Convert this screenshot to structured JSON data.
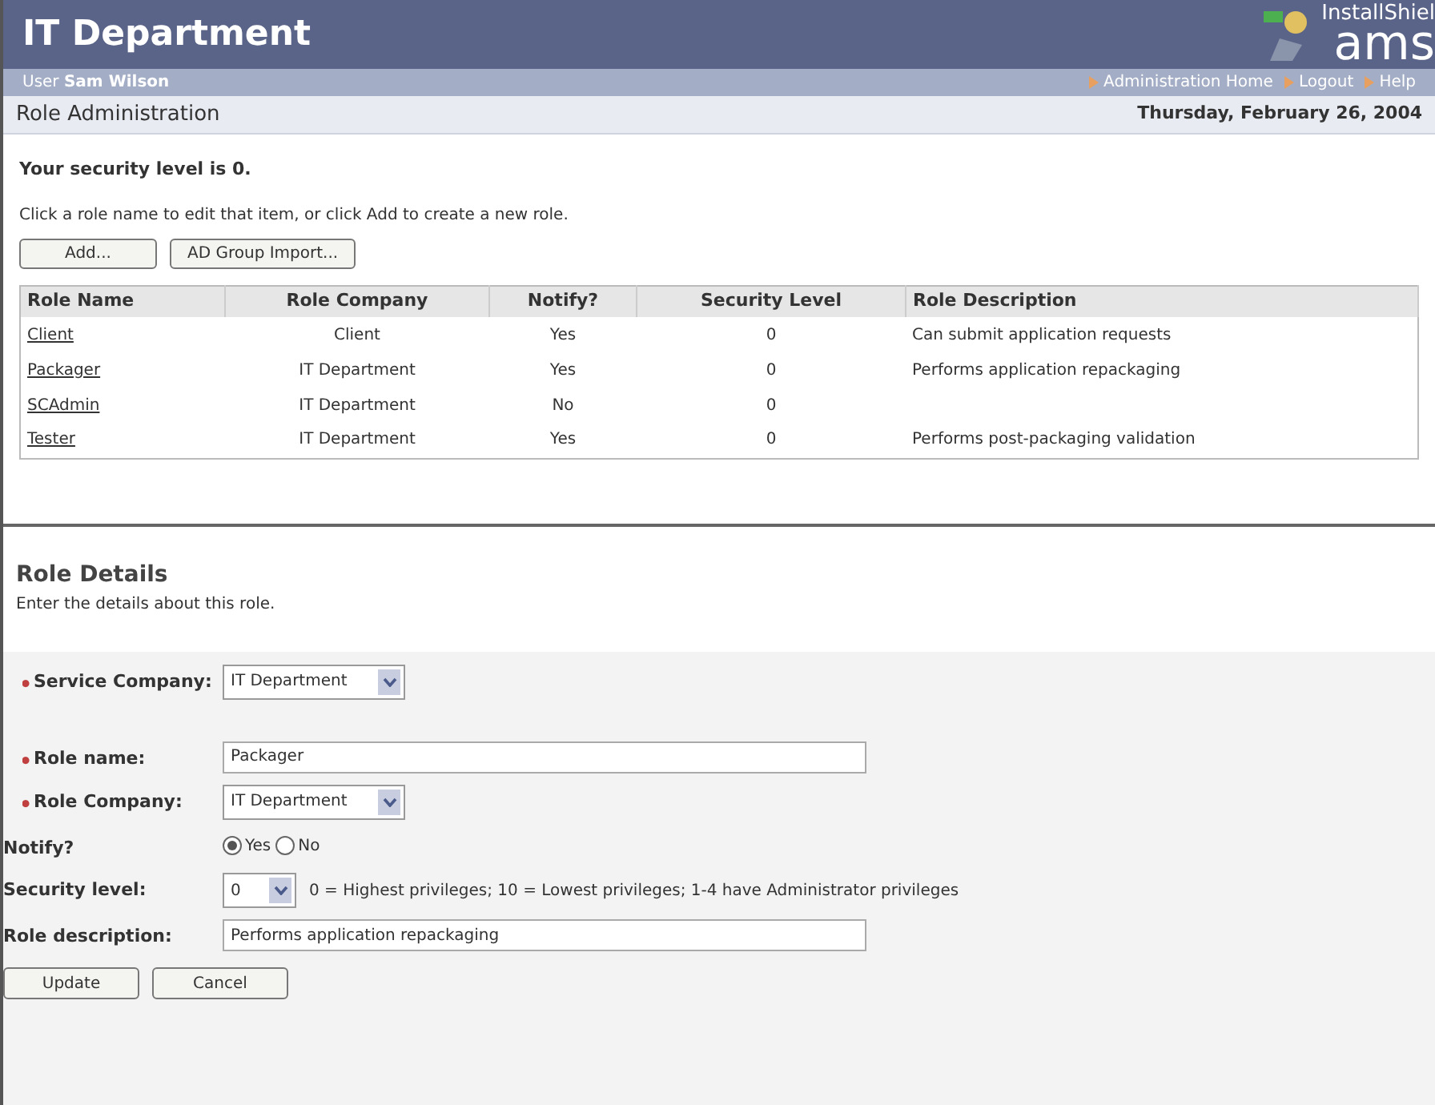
{
  "header": {
    "title": "IT Department",
    "logo_top": "InstallShiel",
    "logo_main": "ams"
  },
  "user_bar": {
    "prefix": "User",
    "user": "Sam Wilson",
    "links": [
      "Administration Home",
      "Logout",
      "Help"
    ]
  },
  "title_bar": {
    "title": "Role Administration",
    "date": "Thursday, February 26, 2004"
  },
  "security_note": "Your security level is 0.",
  "instructions": "Click a role name to edit that item, or click Add to create a new role.",
  "buttons": [
    "Add...",
    "AD Group Import..."
  ],
  "table": {
    "columns": [
      "Role Name",
      "Role Company",
      "Notify?",
      "Security Level",
      "Role Description"
    ],
    "rows": [
      {
        "cells": [
          "Client",
          "Client",
          "Yes",
          "0",
          "Can submit application requests"
        ]
      },
      {
        "cells": [
          "Packager",
          "IT Department",
          "Yes",
          "0",
          "Performs application repackaging"
        ]
      },
      {
        "cells": [
          "SCAdmin",
          "IT Department",
          "No",
          "0",
          ""
        ]
      },
      {
        "cells": [
          "Tester",
          "IT Department",
          "Yes",
          "0",
          "Performs post-packaging validation"
        ]
      }
    ]
  },
  "details": {
    "title": "Role Details",
    "subtitle": "Enter the details about this role.",
    "fields": [
      {
        "kind": "select",
        "label": "Service Company:",
        "required": true,
        "value": "IT Department"
      },
      {
        "kind": "text",
        "label": "Role name:",
        "required": true,
        "value": "Packager"
      },
      {
        "kind": "select",
        "label": "Role Company:",
        "required": true,
        "value": "IT Department"
      },
      {
        "kind": "radio",
        "label": "Notify?",
        "required": false,
        "options": [
          {
            "label": "Yes",
            "selected": true
          },
          {
            "label": "No",
            "selected": false
          }
        ]
      },
      {
        "kind": "small_select",
        "label": "Security level:",
        "required": false,
        "value": "0",
        "note": "0 = Highest privileges; 10 = Lowest privileges; 1-4 have Administrator privileges"
      },
      {
        "kind": "text",
        "label": "Role description:",
        "required": false,
        "value": "Performs application repackaging"
      }
    ],
    "buttons": [
      "Update",
      "Cancel"
    ]
  }
}
